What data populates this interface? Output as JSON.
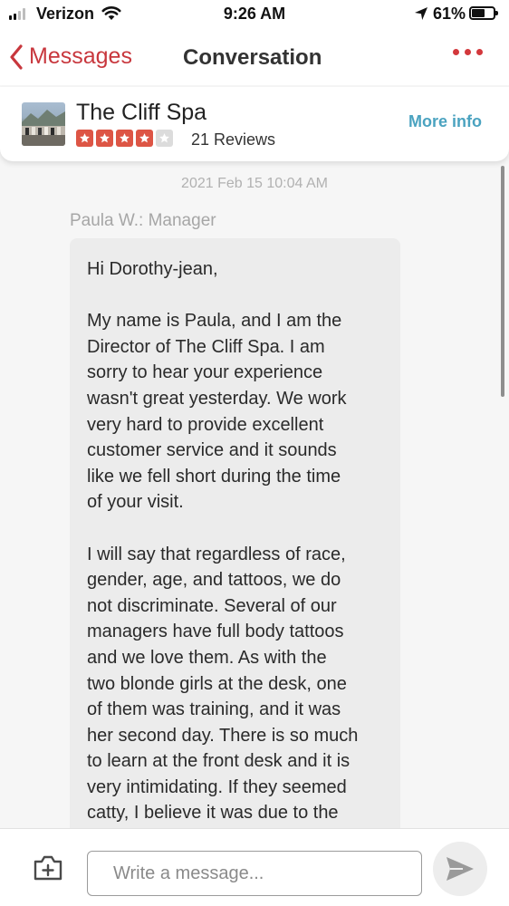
{
  "status_bar": {
    "carrier": "Verizon",
    "time": "9:26 AM",
    "battery_percent": "61%",
    "battery_level": 0.61,
    "signal_bars_active": 2,
    "signal_bars_total": 4,
    "icons": [
      "signal-icon",
      "wifi-icon",
      "location-arrow-icon",
      "battery-icon"
    ]
  },
  "nav": {
    "back_label": "Messages",
    "title": "Conversation",
    "icons": [
      "chevron-left-icon",
      "more-dots-icon"
    ]
  },
  "business": {
    "name": "The Cliff Spa",
    "rating": 4,
    "rating_max": 5,
    "reviews_label": "21 Reviews",
    "more_info_label": "More info"
  },
  "conversation": {
    "timestamp": "2021 Feb 15 10:04 AM",
    "sender": "Paula W.: Manager",
    "message_paragraphs": [
      "Hi Dorothy-jean,",
      "My name is Paula, and I am the\nDirector of The Cliff Spa. I am\nsorry to hear your experience\nwasn't great yesterday. We work\nvery hard to provide excellent\ncustomer service and it sounds\nlike we fell short during the time\nof your visit.",
      "I will say that regardless of race,\ngender, age, and tattoos, we do\nnot discriminate. Several of our\nmanagers have full body tattoos\nand we love them. As with the\ntwo blonde girls at the desk, one\nof them was training, and it was\nher second day. There is so much\nto learn at the front desk and it is\nvery intimidating. If they seemed\ncatty, I believe it was due to the"
    ]
  },
  "composer": {
    "placeholder": "Write a message...",
    "icons": [
      "add-photo-icon",
      "send-icon"
    ]
  },
  "colors": {
    "brand_red": "#c8373d",
    "star_red": "#dd5545",
    "link_blue": "#4ba3c0",
    "bubble_gray": "#ececec"
  }
}
